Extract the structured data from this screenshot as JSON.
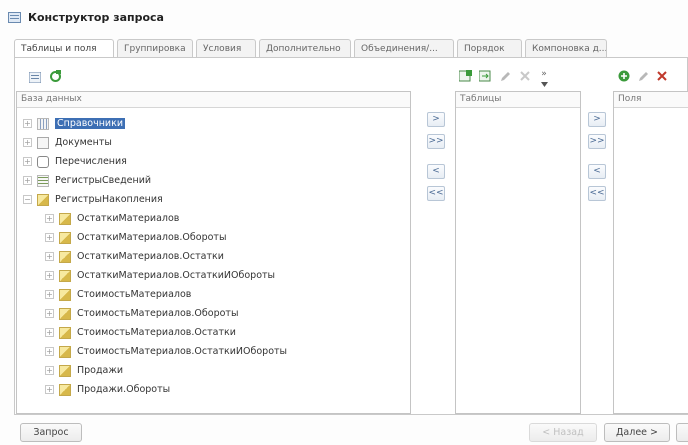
{
  "window": {
    "title": "Конструктор запроса",
    "icon": "query-designer-icon"
  },
  "tabs": [
    {
      "label": "Таблицы и поля",
      "active": true
    },
    {
      "label": "Группировка"
    },
    {
      "label": "Условия"
    },
    {
      "label": "Дополнительно"
    },
    {
      "label": "Объединения/..."
    },
    {
      "label": "Порядок"
    },
    {
      "label": "Компоновка д..."
    }
  ],
  "database_panel": {
    "header": "База данных",
    "items": [
      {
        "label": "Справочники",
        "icon": "catalog-icon",
        "expander": "+",
        "selected": true
      },
      {
        "label": "Документы",
        "icon": "document-icon",
        "expander": "+"
      },
      {
        "label": "Перечисления",
        "icon": "enum-icon",
        "expander": "+"
      },
      {
        "label": "РегистрыСведений",
        "icon": "info-register-icon",
        "expander": "+"
      },
      {
        "label": "РегистрыНакопления",
        "icon": "accumulation-register-icon",
        "expander": "−"
      },
      {
        "label": "ОстаткиМатериалов",
        "icon": "accumulation-register-icon",
        "expander": "+"
      },
      {
        "label": "ОстаткиМатериалов.Обороты",
        "icon": "accumulation-register-icon",
        "expander": "+"
      },
      {
        "label": "ОстаткиМатериалов.Остатки",
        "icon": "accumulation-register-icon",
        "expander": "+"
      },
      {
        "label": "ОстаткиМатериалов.ОстаткиИОбороты",
        "icon": "accumulation-register-icon",
        "expander": "+"
      },
      {
        "label": "СтоимостьМатериалов",
        "icon": "accumulation-register-icon",
        "expander": "+"
      },
      {
        "label": "СтоимостьМатериалов.Обороты",
        "icon": "accumulation-register-icon",
        "expander": "+"
      },
      {
        "label": "СтоимостьМатериалов.Остатки",
        "icon": "accumulation-register-icon",
        "expander": "+"
      },
      {
        "label": "СтоимостьМатериалов.ОстаткиИОбороты",
        "icon": "accumulation-register-icon",
        "expander": "+"
      },
      {
        "label": "Продажи",
        "icon": "accumulation-register-icon",
        "expander": "+"
      },
      {
        "label": "Продажи.Обороты",
        "icon": "accumulation-register-icon",
        "expander": "+"
      }
    ]
  },
  "transfer_buttons": {
    "add": ">",
    "add_all": ">>",
    "remove": "<",
    "remove_all": "<<"
  },
  "tables_panel": {
    "header": "Таблицы"
  },
  "fields_panel": {
    "header": "Поля"
  },
  "toolbar": {
    "more": "»"
  },
  "footer": {
    "query_button": "Запрос",
    "back_button": "< Назад",
    "next_button": "Далее >"
  },
  "colors": {
    "selection": "#3d6fb4",
    "accent_green": "#3a9a3a",
    "accent_red": "#c0392b"
  }
}
